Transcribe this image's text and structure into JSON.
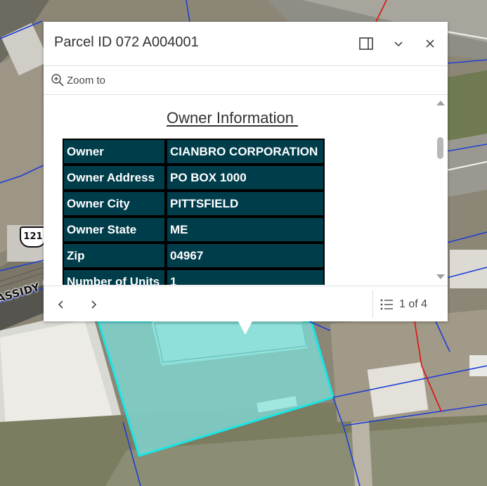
{
  "popup": {
    "title": "Parcel ID 072 A004001",
    "actions": {
      "zoom_to_label": "Zoom to"
    },
    "section_title": "Owner Information ",
    "owner_table": [
      {
        "field": "Owner",
        "value": "CIANBRO CORPORATION"
      },
      {
        "field": "Owner Address",
        "value": "PO BOX 1000"
      },
      {
        "field": "Owner City",
        "value": "PITTSFIELD"
      },
      {
        "field": "Owner State",
        "value": "ME"
      },
      {
        "field": "Zip",
        "value": "04967"
      },
      {
        "field": "Number of Units",
        "value": "1"
      }
    ],
    "pager": {
      "label": "1 of 4"
    },
    "icons": {
      "dock": "dock-panel-icon",
      "collapse": "chevron-down-icon",
      "close": "close-icon",
      "zoom": "zoom-in-icon",
      "prev": "chevron-left-icon",
      "next": "chevron-right-icon",
      "list": "list-icon"
    }
  },
  "map": {
    "road_label": "ASSIDY P",
    "route_shield": "121",
    "colors": {
      "parcel_highlight": "#19e6e6",
      "parcel_fill": "#7fd3cf",
      "parcel_lines": "#1f3fd6",
      "boundary_red": "#e01010",
      "table_cell": "#003d4b"
    }
  }
}
